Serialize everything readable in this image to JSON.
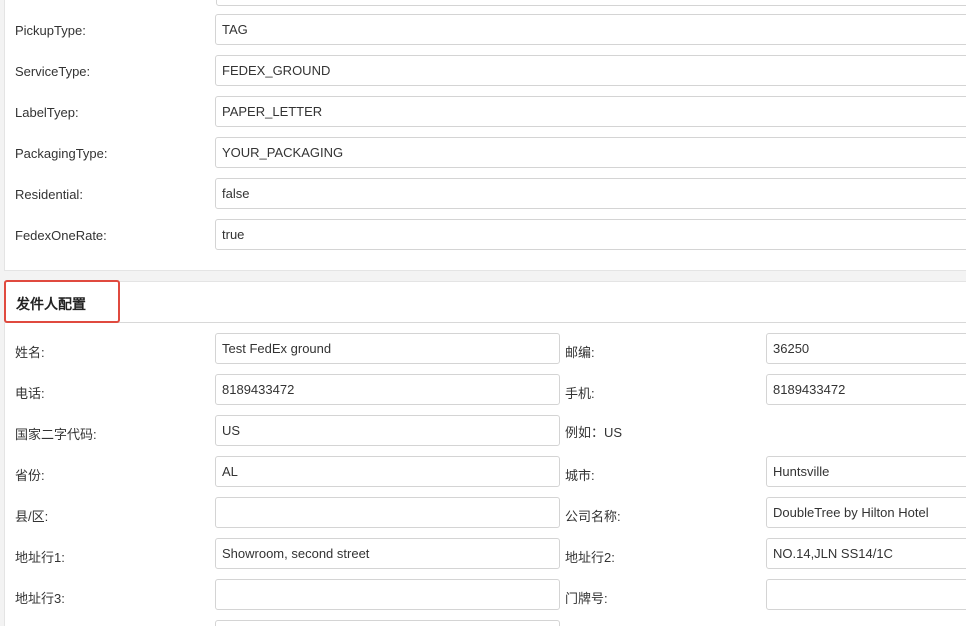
{
  "shipping_config": {
    "fields": [
      {
        "label": "PickupType:",
        "value": "TAG"
      },
      {
        "label": "ServiceType:",
        "value": "FEDEX_GROUND"
      },
      {
        "label": "LabelTyep:",
        "value": "PAPER_LETTER"
      },
      {
        "label": "PackagingType:",
        "value": "YOUR_PACKAGING"
      },
      {
        "label": "Residential:",
        "value": "false"
      },
      {
        "label": "FedexOneRate:",
        "value": "true"
      }
    ]
  },
  "sender": {
    "section_title": "发件人配置",
    "name_label": "姓名:",
    "name_value": "Test FedEx ground",
    "zip_label": "邮编:",
    "zip_value": "36250",
    "phone_label": "电话:",
    "phone_value": "8189433472",
    "mobile_label": "手机:",
    "mobile_value": "8189433472",
    "country_label": "国家二字代码:",
    "country_value": "US",
    "country_hint": "例如：US",
    "province_label": "省份:",
    "province_value": "AL",
    "city_label": "城市:",
    "city_value": "Huntsville",
    "county_label": "县/区:",
    "county_value": "",
    "company_label": "公司名称:",
    "company_value": "DoubleTree by Hilton Hotel",
    "address1_label": "地址行1:",
    "address1_value": "Showroom, second street",
    "address2_label": "地址行2:",
    "address2_value": "NO.14,JLN SS14/1C",
    "address3_label": "地址行3:",
    "address3_value": "",
    "door_label": "门牌号:",
    "door_value": ""
  }
}
